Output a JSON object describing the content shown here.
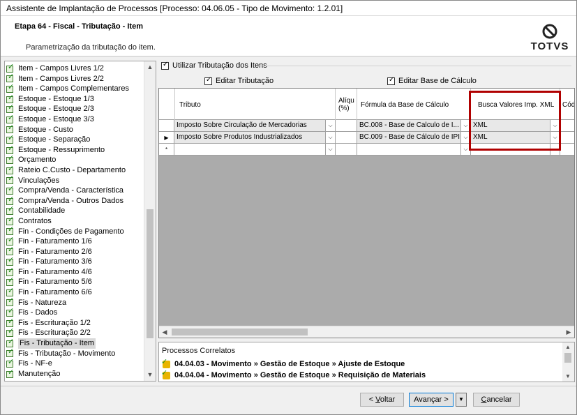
{
  "window": {
    "title": "Assistente de Implantação de Processos [Processo: 04.06.05 - Tipo de Movimento: 1.2.01]"
  },
  "header": {
    "step": "Etapa 64 - Fiscal - Tributação - Item",
    "description": "Parametrização da tributação do item.",
    "logo_text": "TOTVS"
  },
  "tree": {
    "items": [
      {
        "label": "Item - Campos Livres 1/2"
      },
      {
        "label": "Item - Campos Livres 2/2"
      },
      {
        "label": "Item - Campos Complementares"
      },
      {
        "label": "Estoque - Estoque 1/3"
      },
      {
        "label": "Estoque - Estoque 2/3"
      },
      {
        "label": "Estoque - Estoque 3/3"
      },
      {
        "label": "Estoque - Custo"
      },
      {
        "label": "Estoque - Separação"
      },
      {
        "label": "Estoque - Ressuprimento"
      },
      {
        "label": "Orçamento"
      },
      {
        "label": "Rateio C.Custo - Departamento"
      },
      {
        "label": "Vinculações"
      },
      {
        "label": "Compra/Venda - Característica"
      },
      {
        "label": "Compra/Venda - Outros Dados"
      },
      {
        "label": "Contabilidade"
      },
      {
        "label": "Contratos"
      },
      {
        "label": "Fin - Condições de Pagamento"
      },
      {
        "label": "Fin - Faturamento 1/6"
      },
      {
        "label": "Fin - Faturamento 2/6"
      },
      {
        "label": "Fin - Faturamento 3/6"
      },
      {
        "label": "Fin - Faturamento 4/6"
      },
      {
        "label": "Fin - Faturamento 5/6"
      },
      {
        "label": "Fin - Faturamento 6/6"
      },
      {
        "label": "Fis - Natureza"
      },
      {
        "label": "Fis - Dados"
      },
      {
        "label": "Fis - Escrituração 1/2"
      },
      {
        "label": "Fis - Escrituração 2/2"
      },
      {
        "label": "Fis - Tributação - Item"
      },
      {
        "label": "Fis - Tributação - Movimento"
      },
      {
        "label": "Fis - NF-e"
      },
      {
        "label": "Manutenção"
      }
    ],
    "selected_index": 27
  },
  "options": {
    "use_item_taxation": "Utilizar Tributação dos Itens",
    "edit_taxation": "Editar Tributação",
    "edit_base": "Editar Base de Cálculo"
  },
  "grid": {
    "columns": {
      "tributo": "Tributo",
      "aliquota": "Alíqu (%)",
      "formula": "Fórmula da Base de Cálculo",
      "busca": "Busca Valores Imp. XML",
      "cod": "Cód"
    },
    "rows": [
      {
        "marker": "",
        "tributo": "Imposto Sobre Circulação de Mercadorias",
        "aliquota": "",
        "formula": "BC.008 - Base de Calculo de I...",
        "busca": "XML"
      },
      {
        "marker": "▶",
        "tributo": "Imposto Sobre Produtos Industrializados",
        "aliquota": "",
        "formula": "BC.009 - Base de Cálculo de IPI",
        "busca": "XML"
      },
      {
        "marker": "*",
        "tributo": "",
        "aliquota": "",
        "formula": "",
        "busca": ""
      }
    ]
  },
  "related": {
    "title": "Processos Correlatos",
    "items": [
      {
        "label": "04.04.03 - Movimento » Gestão de Estoque » Ajuste de Estoque"
      },
      {
        "label": "04.04.04 - Movimento » Gestão de Estoque » Requisição de Materiais"
      }
    ]
  },
  "buttons": {
    "back_prefix": "< ",
    "back_key": "V",
    "back_rest": "oltar",
    "next_label": "Avançar >",
    "cancel_key": "C",
    "cancel_rest": "ancelar"
  },
  "colors": {
    "highlight": "#b00000",
    "grid_background": "#ababab"
  }
}
